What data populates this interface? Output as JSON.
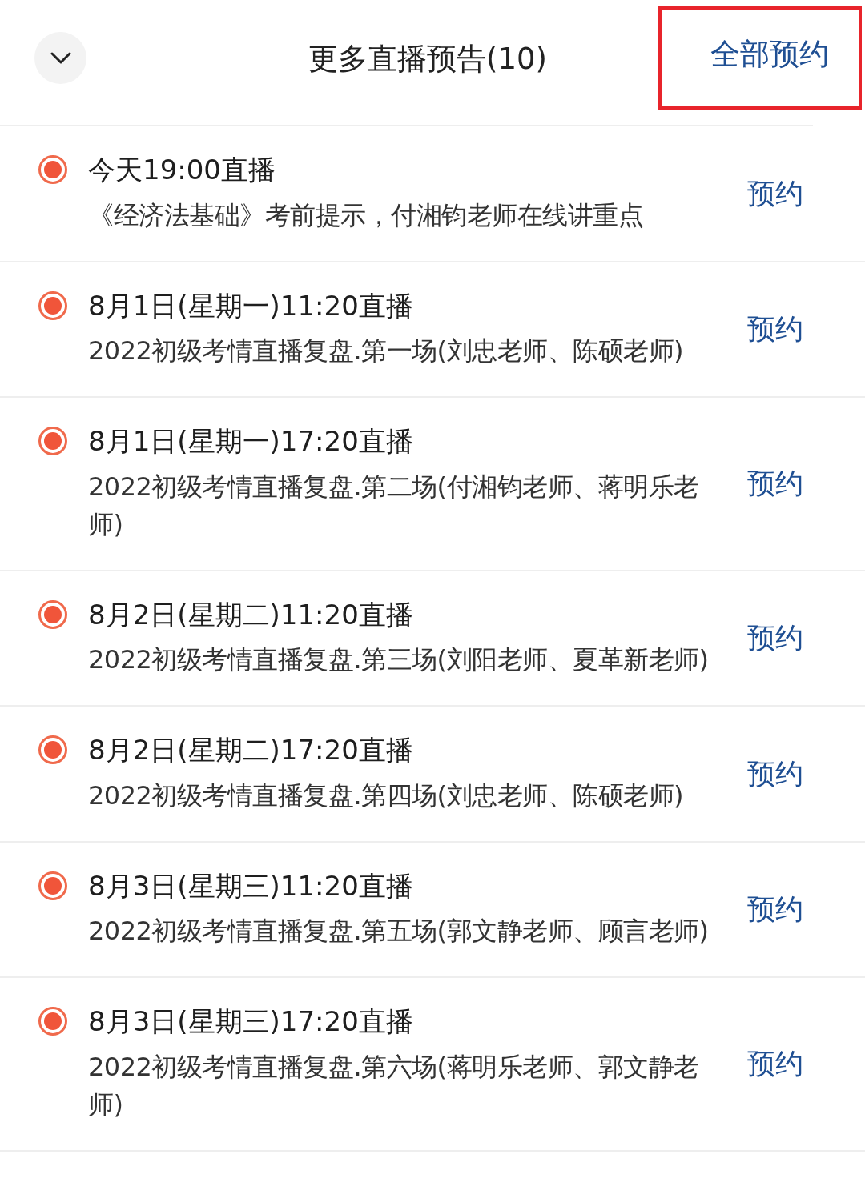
{
  "header": {
    "title": "更多直播预告(10)",
    "action": {
      "label": "全部预约",
      "highlighted": true
    }
  },
  "items": [
    {
      "time": "今天19:00直播",
      "description": "《经济法基础》考前提示，付湘钧老师在线讲重点",
      "button": "预约"
    },
    {
      "time": "8月1日(星期一)11:20直播",
      "description": "2022初级考情直播复盘.第一场(刘忠老师、陈硕老师)",
      "button": "预约"
    },
    {
      "time": "8月1日(星期一)17:20直播",
      "description": "2022初级考情直播复盘.第二场(付湘钧老师、蒋明乐老师)",
      "button": "预约"
    },
    {
      "time": "8月2日(星期二)11:20直播",
      "description": "2022初级考情直播复盘.第三场(刘阳老师、夏革新老师)",
      "button": "预约"
    },
    {
      "time": "8月2日(星期二)17:20直播",
      "description": "2022初级考情直播复盘.第四场(刘忠老师、陈硕老师)",
      "button": "预约"
    },
    {
      "time": "8月3日(星期三)11:20直播",
      "description": "2022初级考情直播复盘.第五场(郭文静老师、顾言老师)",
      "button": "预约"
    },
    {
      "time": "8月3日(星期三)17:20直播",
      "description": "2022初级考情直播复盘.第六场(蒋明乐老师、郭文静老师)",
      "button": "预约"
    }
  ]
}
